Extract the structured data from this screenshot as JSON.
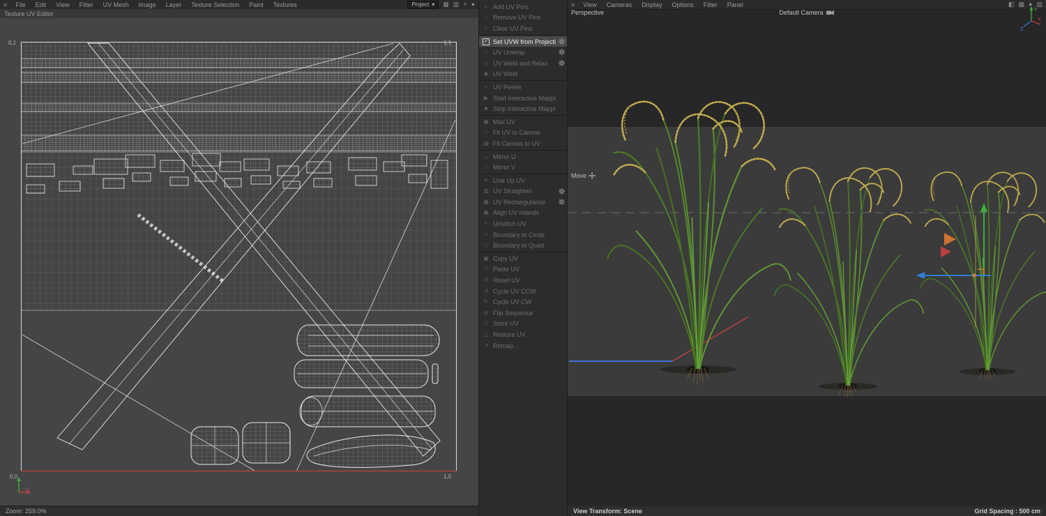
{
  "left": {
    "menubar": {
      "items": [
        "File",
        "Edit",
        "View",
        "Filter",
        "UV Mesh",
        "Image",
        "Layer",
        "Texture Selection",
        "Paint",
        "Textures"
      ],
      "project_dropdown": {
        "label": "Project",
        "caret": "▾"
      },
      "icons_right": [
        "grid-icon",
        "columns-icon",
        "add-icon",
        "record-icon"
      ]
    },
    "tab_label": "Texture UV Editor",
    "uv_canvas": {
      "corner_top_left": "0,1",
      "corner_top_right": "1,1",
      "corner_bottom_left": "0,0",
      "corner_bottom_right": "1,0",
      "axis_label_u": "U"
    },
    "statusbar": {
      "zoom": "Zoom: 259.0%"
    }
  },
  "uv_menu": {
    "groups": [
      {
        "items": [
          {
            "label": "Add UV Pins",
            "icon": "pin-add-icon"
          },
          {
            "label": "Remove UV Pins",
            "icon": "pin-remove-icon"
          },
          {
            "label": "Clear UV Pins",
            "icon": "pin-clear-icon"
          }
        ]
      },
      {
        "items": [
          {
            "label": "Set UVW from Projection",
            "icon": "checkbox-checked-icon",
            "active": true,
            "gear": true
          },
          {
            "label": "UV Unwrap",
            "icon": "unwrap-icon",
            "gear": true
          },
          {
            "label": "UV Weld and Relax",
            "icon": "weld-relax-icon",
            "gear": true
          },
          {
            "label": "UV Weld",
            "icon": "weld-icon"
          }
        ]
      },
      {
        "items": [
          {
            "label": "UV Peeler",
            "icon": "peeler-icon"
          },
          {
            "label": "Start Interactive Mapping",
            "icon": "play-icon"
          },
          {
            "label": "Stop Interactive Mapping",
            "icon": "stop-icon"
          }
        ]
      },
      {
        "items": [
          {
            "label": "Max UV",
            "icon": "max-uv-icon"
          },
          {
            "label": "Fit UV to Canvas",
            "icon": "fit-uv-icon"
          },
          {
            "label": "Fit Canvas to UV",
            "icon": "fit-canvas-icon"
          }
        ]
      },
      {
        "items": [
          {
            "label": "Mirror U",
            "icon": "mirror-u-icon"
          },
          {
            "label": "Mirror V",
            "icon": "mirror-v-icon"
          }
        ]
      },
      {
        "items": [
          {
            "label": "Line Up UV",
            "icon": "line-up-icon"
          },
          {
            "label": "UV Straighten",
            "icon": "straighten-icon",
            "gear": true
          },
          {
            "label": "UV Rectangularize",
            "icon": "rectangularize-icon",
            "gear": true
          },
          {
            "label": "Align UV Islands",
            "icon": "align-islands-icon"
          },
          {
            "label": "Unstitch UV",
            "icon": "unstitch-icon"
          },
          {
            "label": "Boundary to Circle",
            "icon": "boundary-circle-icon"
          },
          {
            "label": "Boundary to Quad",
            "icon": "boundary-quad-icon"
          }
        ]
      },
      {
        "items": [
          {
            "label": "Copy UV",
            "icon": "copy-icon"
          },
          {
            "label": "Paste UV",
            "icon": "paste-icon"
          },
          {
            "label": "Reset UV",
            "icon": "reset-icon"
          },
          {
            "label": "Cycle UV CCW",
            "icon": "cycle-ccw-icon"
          },
          {
            "label": "Cycle UV CW",
            "icon": "cycle-cw-icon"
          },
          {
            "label": "Flip Sequence",
            "icon": "flip-icon"
          },
          {
            "label": "Store UV",
            "icon": "store-icon"
          },
          {
            "label": "Restore UV",
            "icon": "restore-icon"
          },
          {
            "label": "Remap...",
            "icon": "remap-icon"
          }
        ]
      }
    ]
  },
  "viewport": {
    "menubar": {
      "items": [
        "View",
        "Cameras",
        "Display",
        "Options",
        "Filter",
        "Panel"
      ],
      "icons_right": [
        "half-square-icon",
        "grid-icon",
        "record-icon",
        "rows-icon"
      ]
    },
    "view_label": "Perspective",
    "camera_label": "Default Camera",
    "tool_label": "Move",
    "axis": {
      "x": "X",
      "y": "Y",
      "z": "Z"
    },
    "statusbar": {
      "left": "View Transform: Scene",
      "right": "Grid Spacing : 500 cm"
    }
  },
  "colors": {
    "axis_x_red": "#c04040",
    "axis_y_green": "#3fae3f",
    "axis_z_blue": "#2f7fd8",
    "uv_axis_red": "#b04040",
    "highlight_bg": "#4a4a4a",
    "plant_green": "#4b7c26",
    "grain_yellow": "#c3ac4e"
  }
}
